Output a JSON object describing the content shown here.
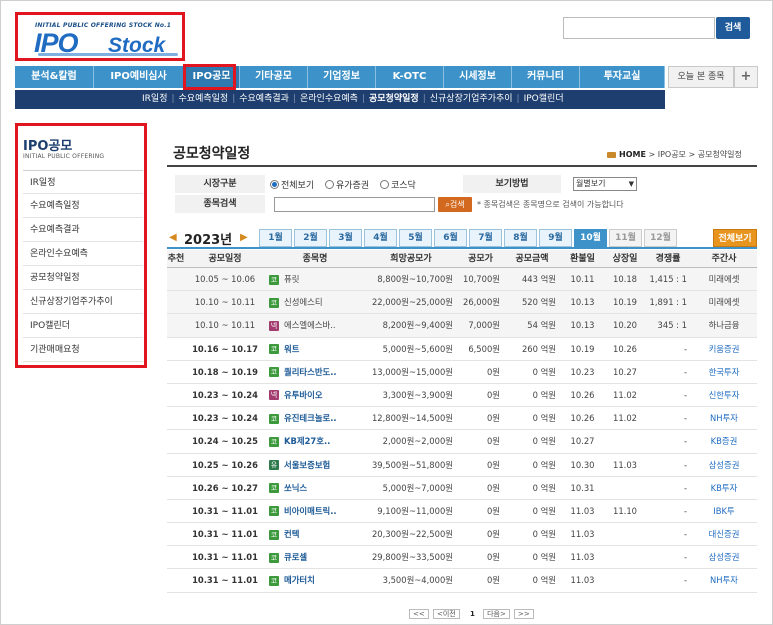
{
  "logo": {
    "tagline": "INITIAL PUBLIC OFFERING STOCK No.1",
    "brand_main": "IPO",
    "brand_sub": "Stock"
  },
  "search": {
    "placeholder": "",
    "button_label": "검색"
  },
  "top_nav": [
    {
      "label": "분석&칼럼",
      "w": 79
    },
    {
      "label": "IPO예비심사",
      "w": 90
    },
    {
      "label": "IPO공모",
      "w": 56,
      "active": true
    },
    {
      "label": "기타공모",
      "w": 68
    },
    {
      "label": "기업정보",
      "w": 68
    },
    {
      "label": "K-OTC",
      "w": 68
    },
    {
      "label": "시세정보",
      "w": 68
    },
    {
      "label": "커뮤니티",
      "w": 68
    },
    {
      "label": "투자교실",
      "w": 85
    }
  ],
  "today_tab": "오늘 본 종목",
  "plus_tab": "+",
  "sub_nav": [
    {
      "label": "IR일정"
    },
    {
      "label": "수요예측일정"
    },
    {
      "label": "수요예측결과"
    },
    {
      "label": "온라인수요예측"
    },
    {
      "label": "공모청약일정",
      "active": true
    },
    {
      "label": "신규상장기업주가추이"
    },
    {
      "label": "IPO캘린더"
    }
  ],
  "sidebar": {
    "title": "IPO공모",
    "subtitle": "INITIAL PUBLIC OFFERING",
    "items": [
      "IR일정",
      "수요예측일정",
      "수요예측결과",
      "온라인수요예측",
      "공모청약일정",
      "신규상장기업주가추이",
      "IPO캘린더",
      "기관매매요청"
    ]
  },
  "page": {
    "title": "공모청약일정",
    "breadcrumb": {
      "home": "HOME",
      "level1": "IPO공모",
      "level2": "공모청약일정",
      "sep": ">"
    }
  },
  "filters": {
    "market_label": "시장구분",
    "market_options": [
      "전체보기",
      "유가증권",
      "코스닥"
    ],
    "market_selected": "전체보기",
    "view_label": "보기방법",
    "view_selected": "월별보기",
    "name_label": "종목검색",
    "name_value": "",
    "name_button": "검색",
    "note": "* 종목검색은 종목명으로 검색이 가능합니다"
  },
  "year": "2023년",
  "year_prev": "◀",
  "year_next": "▶",
  "months": [
    {
      "label": "1월"
    },
    {
      "label": "2월"
    },
    {
      "label": "3월"
    },
    {
      "label": "4월"
    },
    {
      "label": "5월"
    },
    {
      "label": "6월"
    },
    {
      "label": "7월"
    },
    {
      "label": "8월"
    },
    {
      "label": "9월"
    },
    {
      "label": "10월",
      "active": true
    },
    {
      "label": "11월",
      "future": true
    },
    {
      "label": "12월",
      "future": true
    }
  ],
  "view_all": "전체보기",
  "table": {
    "headers": [
      "추천",
      "공모일정",
      "종목명",
      "희망공모가",
      "공모가",
      "공모금액",
      "환불일",
      "상장일",
      "경쟁률",
      "주간사"
    ],
    "rows": [
      {
        "rec": "",
        "date": "10.05 ~ 10.06",
        "badge": "코",
        "name": "퓨릿",
        "hope": "8,800원~10,700원",
        "price": "10,700원",
        "amount": "443 억원",
        "refund": "10.11",
        "listing": "10.18",
        "comp": "1,415 : 1",
        "manager": "미래에셋",
        "type": "past"
      },
      {
        "rec": "",
        "date": "10.10 ~ 10.11",
        "badge": "코",
        "name": "신성에스티",
        "hope": "22,000원~25,000원",
        "price": "26,000원",
        "amount": "520 억원",
        "refund": "10.13",
        "listing": "10.19",
        "comp": "1,891 : 1",
        "manager": "미래에셋",
        "type": "past"
      },
      {
        "rec": "",
        "date": "10.10 ~ 10.11",
        "badge": "넥",
        "name": "에스엘에스바..",
        "hope": "8,200원~9,400원",
        "price": "7,000원",
        "amount": "54 억원",
        "refund": "10.13",
        "listing": "10.20",
        "comp": "345 : 1",
        "manager": "하나금융",
        "type": "past"
      },
      {
        "rec": "",
        "date": "10.16 ~ 10.17",
        "badge": "코",
        "name": "워트",
        "hope": "5,000원~5,600원",
        "price": "6,500원",
        "amount": "260 억원",
        "refund": "10.19",
        "listing": "10.26",
        "comp": "-",
        "manager": "키움증권",
        "type": "upcoming"
      },
      {
        "rec": "",
        "date": "10.18 ~ 10.19",
        "badge": "코",
        "name": "퀄리타스반도..",
        "hope": "13,000원~15,000원",
        "price": "0원",
        "amount": "0 억원",
        "refund": "10.23",
        "listing": "10.27",
        "comp": "-",
        "manager": "한국투자",
        "type": "upcoming"
      },
      {
        "rec": "",
        "date": "10.23 ~ 10.24",
        "badge": "넥",
        "name": "유투바이오",
        "hope": "3,300원~3,900원",
        "price": "0원",
        "amount": "0 억원",
        "refund": "10.26",
        "listing": "11.02",
        "comp": "-",
        "manager": "신한투자",
        "type": "upcoming"
      },
      {
        "rec": "",
        "date": "10.23 ~ 10.24",
        "badge": "코",
        "name": "유진테크놀로..",
        "hope": "12,800원~14,500원",
        "price": "0원",
        "amount": "0 억원",
        "refund": "10.26",
        "listing": "11.02",
        "comp": "-",
        "manager": "NH투자",
        "type": "upcoming"
      },
      {
        "rec": "",
        "date": "10.24 ~ 10.25",
        "badge": "코",
        "name": "KB제27호..",
        "hope": "2,000원~2,000원",
        "price": "0원",
        "amount": "0 억원",
        "refund": "10.27",
        "listing": "",
        "comp": "-",
        "manager": "KB증권",
        "type": "upcoming"
      },
      {
        "rec": "",
        "date": "10.25 ~ 10.26",
        "badge": "유",
        "name": "서울보증보험",
        "hope": "39,500원~51,800원",
        "price": "0원",
        "amount": "0 억원",
        "refund": "10.30",
        "listing": "11.03",
        "comp": "-",
        "manager": "삼성증권",
        "type": "upcoming"
      },
      {
        "rec": "",
        "date": "10.26 ~ 10.27",
        "badge": "코",
        "name": "쏘닉스",
        "hope": "5,000원~7,000원",
        "price": "0원",
        "amount": "0 억원",
        "refund": "10.31",
        "listing": "",
        "comp": "-",
        "manager": "KB투자",
        "type": "upcoming"
      },
      {
        "rec": "",
        "date": "10.31 ~ 11.01",
        "badge": "코",
        "name": "비아이매트릭..",
        "hope": "9,100원~11,000원",
        "price": "0원",
        "amount": "0 억원",
        "refund": "11.03",
        "listing": "11.10",
        "comp": "-",
        "manager": "IBK투",
        "type": "upcoming"
      },
      {
        "rec": "",
        "date": "10.31 ~ 11.01",
        "badge": "코",
        "name": "컨텍",
        "hope": "20,300원~22,500원",
        "price": "0원",
        "amount": "0 억원",
        "refund": "11.03",
        "listing": "",
        "comp": "-",
        "manager": "대신증권",
        "type": "upcoming"
      },
      {
        "rec": "",
        "date": "10.31 ~ 11.01",
        "badge": "코",
        "name": "큐로셀",
        "hope": "29,800원~33,500원",
        "price": "0원",
        "amount": "0 억원",
        "refund": "11.03",
        "listing": "",
        "comp": "-",
        "manager": "삼성증권",
        "type": "upcoming"
      },
      {
        "rec": "",
        "date": "10.31 ~ 11.01",
        "badge": "코",
        "name": "메가터치",
        "hope": "3,500원~4,000원",
        "price": "0원",
        "amount": "0 억원",
        "refund": "11.03",
        "listing": "",
        "comp": "-",
        "manager": "NH투자",
        "type": "upcoming"
      }
    ]
  },
  "pager": {
    "first": "<<",
    "prev": "<이전",
    "current": "1",
    "next": "다음>",
    "last": ">>"
  }
}
